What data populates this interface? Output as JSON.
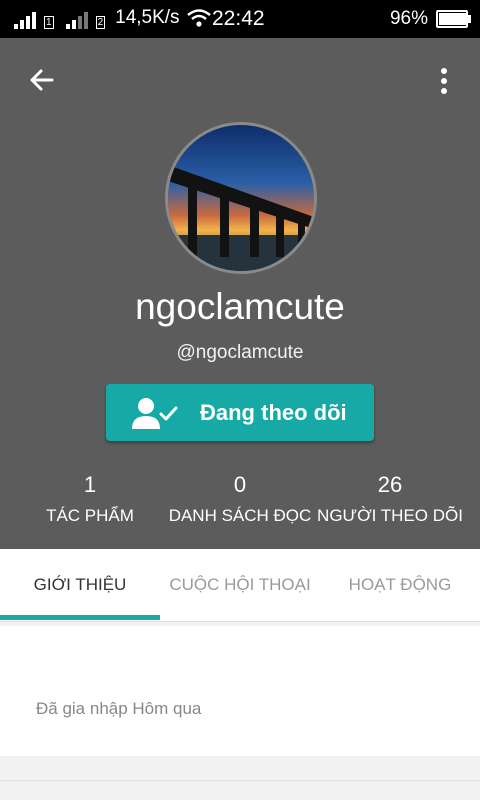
{
  "status_bar": {
    "sim1": "1",
    "sim2": "2",
    "speed": "14,5K/s",
    "time": "22:42",
    "battery": "96%",
    "battery_level": 0.96
  },
  "profile": {
    "username": "ngoclamcute",
    "handle": "@ngoclamcute",
    "follow_button": "Đang theo dõi",
    "stats": [
      {
        "value": "1",
        "label": "TÁC PHẨM"
      },
      {
        "value": "0",
        "label": "DANH SÁCH ĐỌC"
      },
      {
        "value": "26",
        "label": "NGƯỜI THEO DÕI"
      }
    ]
  },
  "tabs": [
    {
      "label": "GIỚI THIỆU",
      "active": true
    },
    {
      "label": "CUỘC HỘI THOẠI",
      "active": false
    },
    {
      "label": "HOẠT ĐỘNG",
      "active": false
    }
  ],
  "about": {
    "joined": "Đã gia nhập Hôm qua"
  },
  "colors": {
    "header": "#5c5c5c",
    "accent": "#17a9a5"
  },
  "icons": {
    "back": "arrow-left-icon",
    "menu": "more-vertical-icon",
    "follow": "user-check-icon",
    "wifi": "wifi-icon",
    "signal": "signal-icon",
    "battery": "battery-icon"
  }
}
